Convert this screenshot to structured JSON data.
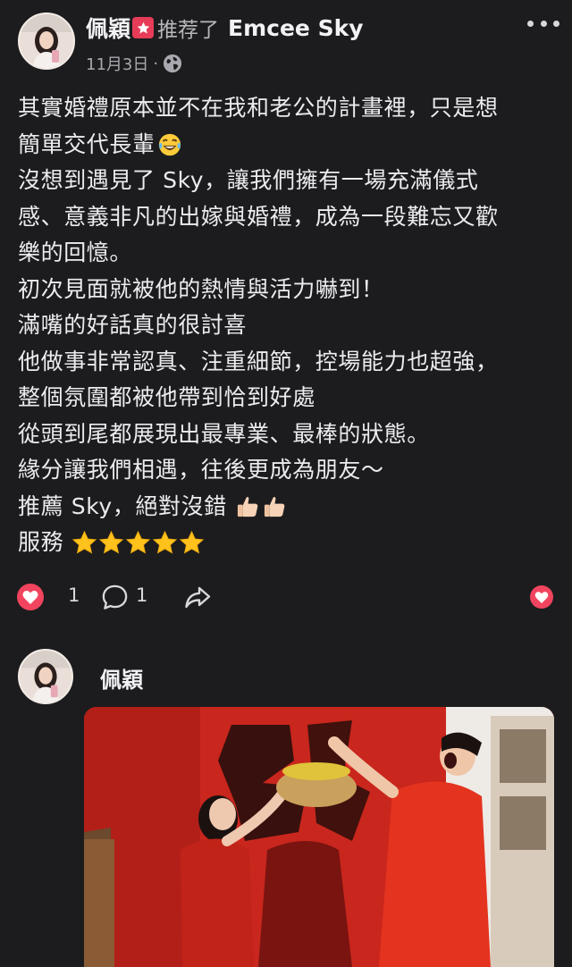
{
  "post": {
    "author": "佩穎",
    "action": "推荐了",
    "page": "Emcee Sky",
    "date": "11月3日",
    "meta_separator": "·",
    "privacy_icon": "globe-icon",
    "badge_icon": "star-badge-icon",
    "lines": {
      "l1": "其實婚禮原本並不在我和老公的計畫裡，只是想",
      "l2": "簡單交代長輩",
      "l3": "沒想到遇見了 Sky，讓我們擁有一場充滿儀式",
      "l4": "感、意義非凡的出嫁與婚禮，成為一段難忘又歡",
      "l5": "樂的回憶。",
      "l6": "初次見面就被他的熱情與活力嚇到！",
      "l7": "滿嘴的好話真的很討喜",
      "l8": "他做事非常認真、注重細節，控場能力也超強，",
      "l9": "整個氛圍都被他帶到恰到好處",
      "l10": "從頭到尾都展現出最專業、最棒的狀態。",
      "l11": "緣分讓我們相遇，往後更成為朋友～",
      "l12": "推薦 Sky，絕對沒錯",
      "l13": "服務"
    },
    "emoji": {
      "laughing": "face-with-tears-of-joy-emoji",
      "thumbs": "thumbs-up-emoji",
      "stars": "star-emoji"
    }
  },
  "reactions": {
    "like_count": "1",
    "comment_count": "1"
  },
  "comment": {
    "author": "佩穎"
  },
  "colors": {
    "background": "#1c1c1e",
    "accent_red": "#e63c58",
    "text": "#ececef",
    "muted": "#a8a8ae"
  }
}
